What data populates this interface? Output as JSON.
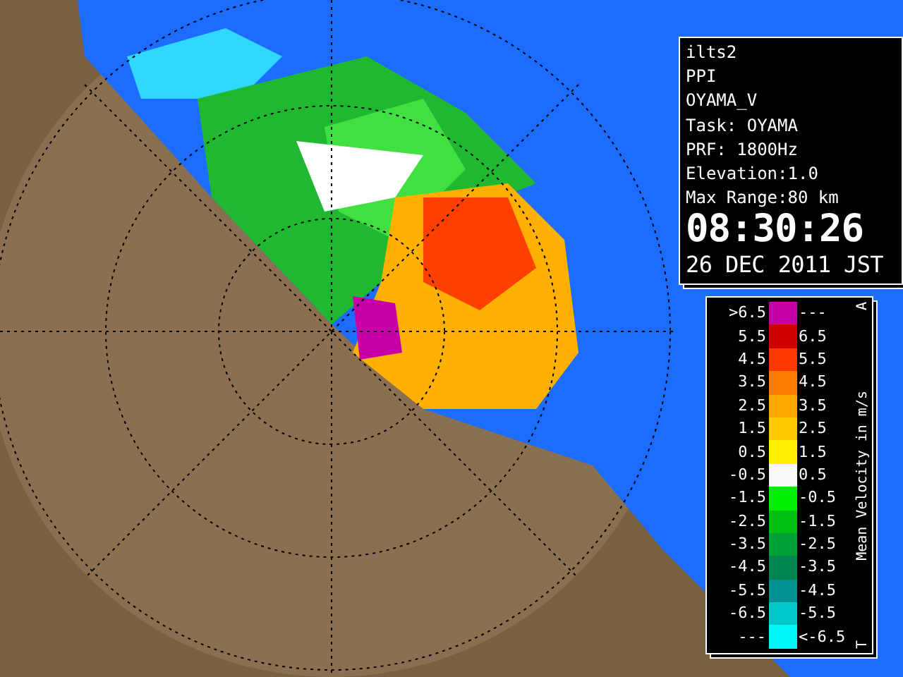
{
  "info_panel": {
    "lines": [
      "ilts2",
      "PPI",
      "OYAMA_V",
      "Task: OYAMA",
      "PRF: 1800Hz",
      "Elevation:1.0",
      "Max Range:80 km"
    ],
    "time": "08:30:26",
    "date": "26 DEC 2011 JST"
  },
  "legend": {
    "title": "Mean Velocity in m/s",
    "top_mark": "A",
    "bottom_mark": "T",
    "rows": [
      {
        "low": ">6.5",
        "high": "---",
        "color": "#c800a8"
      },
      {
        "low": "5.5",
        "high": "6.5",
        "color": "#d00000"
      },
      {
        "low": "4.5",
        "high": "5.5",
        "color": "#ff3800"
      },
      {
        "low": "3.5",
        "high": "4.5",
        "color": "#ff7c00"
      },
      {
        "low": "2.5",
        "high": "3.5",
        "color": "#ffa800"
      },
      {
        "low": "1.5",
        "high": "2.5",
        "color": "#ffc800"
      },
      {
        "low": "0.5",
        "high": "1.5",
        "color": "#fff000"
      },
      {
        "low": "-0.5",
        "high": "0.5",
        "color": "#f8f8f8"
      },
      {
        "low": "-1.5",
        "high": "-0.5",
        "color": "#00f000"
      },
      {
        "low": "-2.5",
        "high": "-1.5",
        "color": "#00c010"
      },
      {
        "low": "-3.5",
        "high": "-2.5",
        "color": "#00a038"
      },
      {
        "low": "-4.5",
        "high": "-3.5",
        "color": "#008450"
      },
      {
        "low": "-5.5",
        "high": "-4.5",
        "color": "#009090"
      },
      {
        "low": "-6.5",
        "high": "-5.5",
        "color": "#00c8c8"
      },
      {
        "low": "---",
        "high": "<-6.5",
        "color": "#00f8f8"
      }
    ]
  }
}
